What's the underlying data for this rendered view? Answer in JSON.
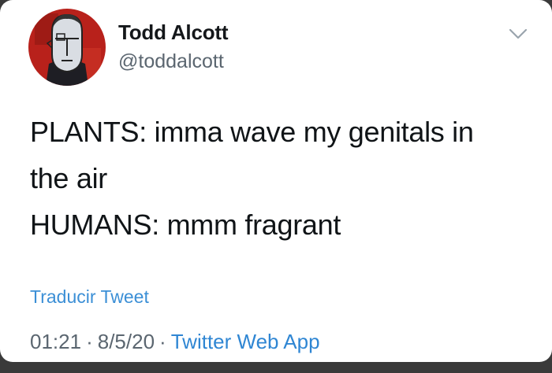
{
  "author": {
    "name": "Todd Alcott",
    "handle": "@toddalcott",
    "avatar_icon": "portrait-avatar"
  },
  "tweet": {
    "lines": [
      "PLANTS: imma wave my genitals in",
      "the air",
      "HUMANS: mmm fragrant"
    ],
    "translate_label": "Traducir Tweet"
  },
  "meta": {
    "time": "01:21",
    "date": "8/5/20",
    "separator": "·",
    "source": "Twitter Web App"
  },
  "colors": {
    "link": "#2f86d3",
    "secondary_text": "#5b6670",
    "avatar_bg": "#b8211b"
  }
}
